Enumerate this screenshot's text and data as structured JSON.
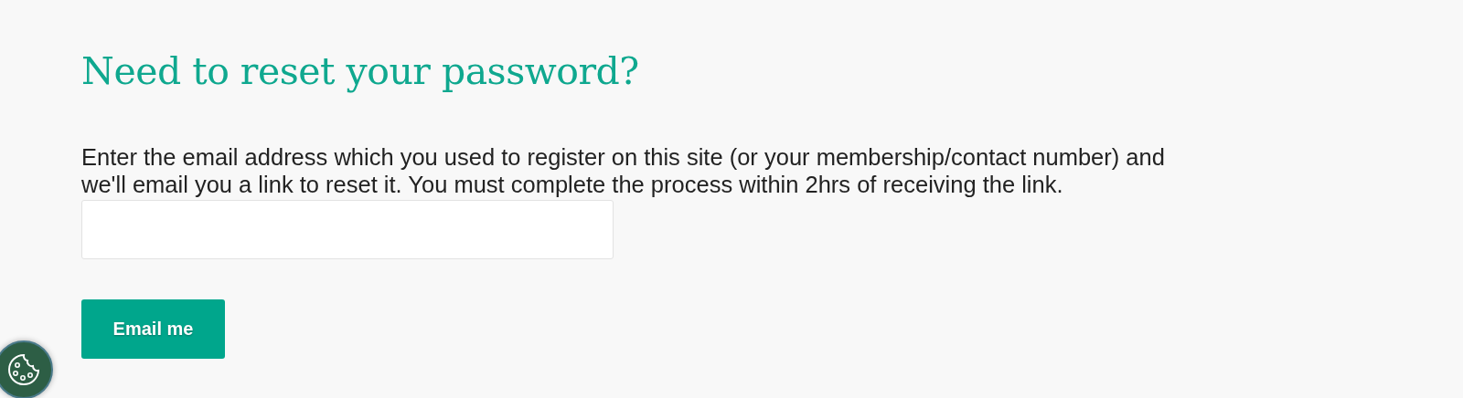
{
  "heading": "Need to reset your password?",
  "instructions": "Enter the email address which you used to register on this site (or your membership/contact number) and we'll email you a link to reset it. You must complete the process within 2hrs of receiving the link.",
  "submit_button": "Email me"
}
